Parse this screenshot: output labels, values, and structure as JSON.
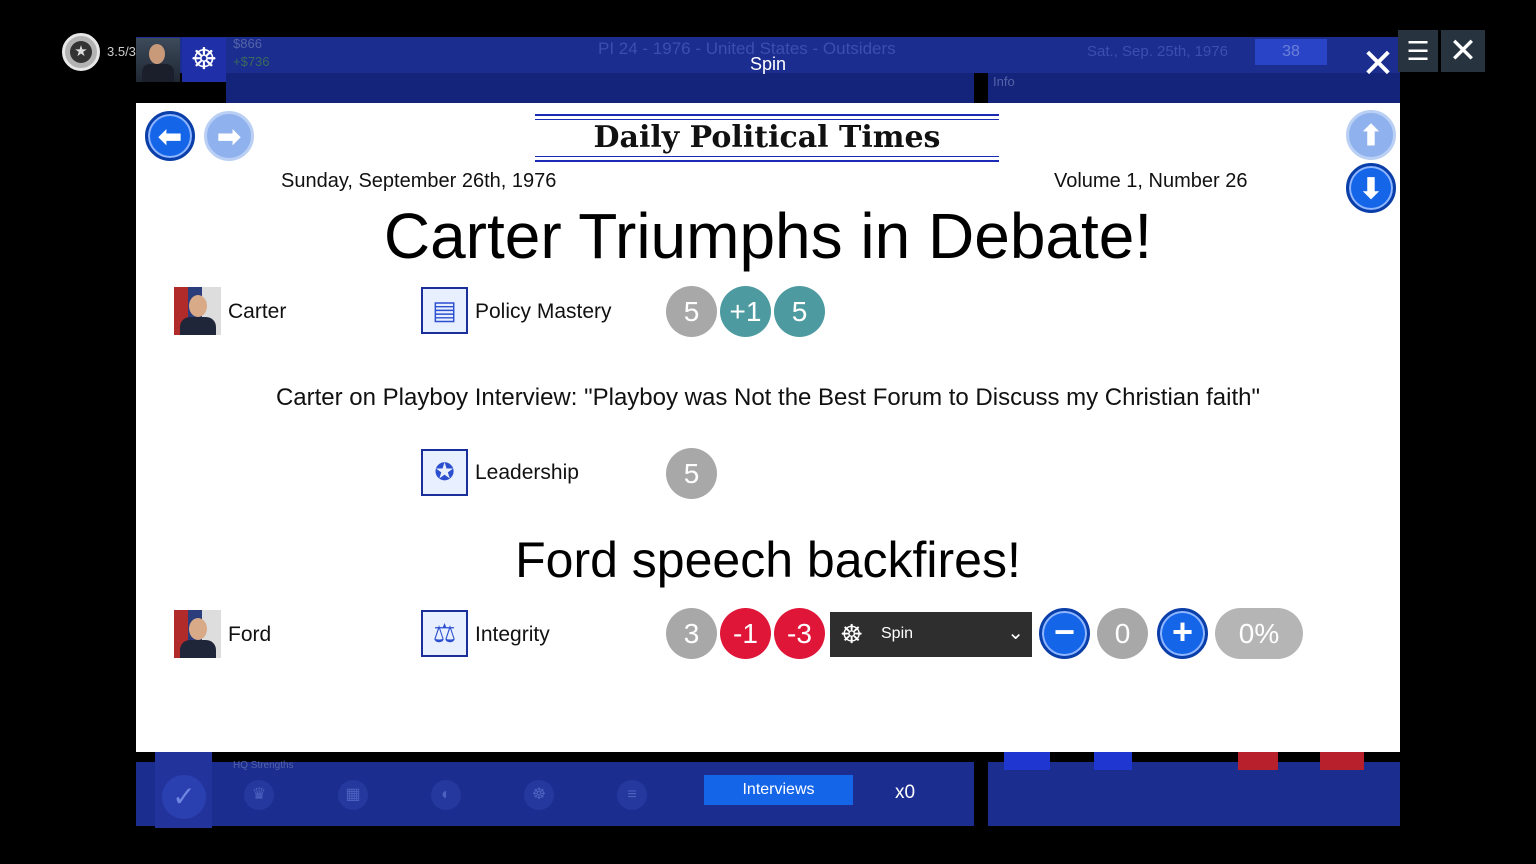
{
  "topbar": {
    "rating": "3.5/3",
    "funds": "$866",
    "funds_change": "+$736",
    "scenario_title": "PI 24 - 1976 - United States - Outsiders",
    "current_date": "Sat., Sep. 25th, 1976",
    "days_value": "38",
    "info_label": "Info",
    "mode_title": "Spin"
  },
  "newspaper": {
    "masthead": "Daily Political Times",
    "date": "Sunday, September 26th, 1976",
    "volume": "Volume 1, Number 26",
    "headline_1": "Carter Triumphs in Debate!",
    "headline_2": "Ford speech backfires!",
    "subheadline": "Carter on Playboy Interview: \"Playboy was Not the Best Forum to Discuss my Christian faith\""
  },
  "rows": {
    "carter": {
      "name": "Carter",
      "trait": "Policy Mastery",
      "values": [
        "5",
        "+1",
        "5"
      ]
    },
    "leadership": {
      "trait": "Leadership",
      "values": [
        "5"
      ]
    },
    "ford": {
      "name": "Ford",
      "trait": "Integrity",
      "values": [
        "3",
        "-1",
        "-3"
      ],
      "spin_option": "Spin",
      "spin_amount": "0",
      "percent": "0%"
    }
  },
  "bottom": {
    "hq_label": "HQ Strengths",
    "interviews_button": "Interviews",
    "multiplier": "x0"
  },
  "icons": [
    "star-icon",
    "ship-wheel-icon",
    "close-icon",
    "menu-icon",
    "back-arrow-icon",
    "forward-arrow-icon",
    "scroll-up-icon",
    "scroll-down-icon",
    "books-icon",
    "star-badge-icon",
    "scales-icon",
    "minus-icon",
    "plus-icon",
    "chevron-down-icon",
    "check-icon"
  ],
  "colors": {
    "accent_blue": "#1565e8",
    "teal_positive": "#4d9ba1",
    "red_negative": "#e01638",
    "neutral_gray": "#a8a8a8"
  }
}
